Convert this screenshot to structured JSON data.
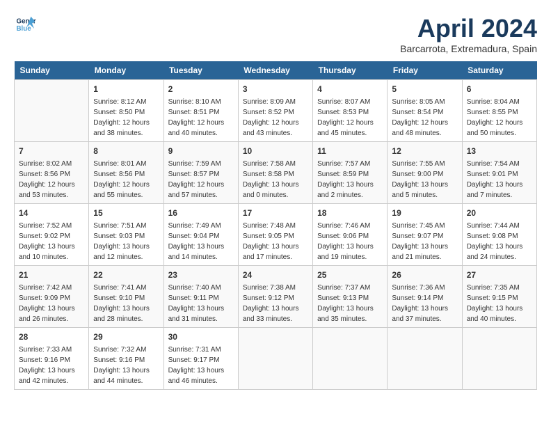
{
  "header": {
    "logo_line1": "General",
    "logo_line2": "Blue",
    "month": "April 2024",
    "location": "Barcarrota, Extremadura, Spain"
  },
  "weekdays": [
    "Sunday",
    "Monday",
    "Tuesday",
    "Wednesday",
    "Thursday",
    "Friday",
    "Saturday"
  ],
  "weeks": [
    [
      {
        "day": "",
        "info": ""
      },
      {
        "day": "1",
        "info": "Sunrise: 8:12 AM\nSunset: 8:50 PM\nDaylight: 12 hours\nand 38 minutes."
      },
      {
        "day": "2",
        "info": "Sunrise: 8:10 AM\nSunset: 8:51 PM\nDaylight: 12 hours\nand 40 minutes."
      },
      {
        "day": "3",
        "info": "Sunrise: 8:09 AM\nSunset: 8:52 PM\nDaylight: 12 hours\nand 43 minutes."
      },
      {
        "day": "4",
        "info": "Sunrise: 8:07 AM\nSunset: 8:53 PM\nDaylight: 12 hours\nand 45 minutes."
      },
      {
        "day": "5",
        "info": "Sunrise: 8:05 AM\nSunset: 8:54 PM\nDaylight: 12 hours\nand 48 minutes."
      },
      {
        "day": "6",
        "info": "Sunrise: 8:04 AM\nSunset: 8:55 PM\nDaylight: 12 hours\nand 50 minutes."
      }
    ],
    [
      {
        "day": "7",
        "info": "Sunrise: 8:02 AM\nSunset: 8:56 PM\nDaylight: 12 hours\nand 53 minutes."
      },
      {
        "day": "8",
        "info": "Sunrise: 8:01 AM\nSunset: 8:56 PM\nDaylight: 12 hours\nand 55 minutes."
      },
      {
        "day": "9",
        "info": "Sunrise: 7:59 AM\nSunset: 8:57 PM\nDaylight: 12 hours\nand 57 minutes."
      },
      {
        "day": "10",
        "info": "Sunrise: 7:58 AM\nSunset: 8:58 PM\nDaylight: 13 hours\nand 0 minutes."
      },
      {
        "day": "11",
        "info": "Sunrise: 7:57 AM\nSunset: 8:59 PM\nDaylight: 13 hours\nand 2 minutes."
      },
      {
        "day": "12",
        "info": "Sunrise: 7:55 AM\nSunset: 9:00 PM\nDaylight: 13 hours\nand 5 minutes."
      },
      {
        "day": "13",
        "info": "Sunrise: 7:54 AM\nSunset: 9:01 PM\nDaylight: 13 hours\nand 7 minutes."
      }
    ],
    [
      {
        "day": "14",
        "info": "Sunrise: 7:52 AM\nSunset: 9:02 PM\nDaylight: 13 hours\nand 10 minutes."
      },
      {
        "day": "15",
        "info": "Sunrise: 7:51 AM\nSunset: 9:03 PM\nDaylight: 13 hours\nand 12 minutes."
      },
      {
        "day": "16",
        "info": "Sunrise: 7:49 AM\nSunset: 9:04 PM\nDaylight: 13 hours\nand 14 minutes."
      },
      {
        "day": "17",
        "info": "Sunrise: 7:48 AM\nSunset: 9:05 PM\nDaylight: 13 hours\nand 17 minutes."
      },
      {
        "day": "18",
        "info": "Sunrise: 7:46 AM\nSunset: 9:06 PM\nDaylight: 13 hours\nand 19 minutes."
      },
      {
        "day": "19",
        "info": "Sunrise: 7:45 AM\nSunset: 9:07 PM\nDaylight: 13 hours\nand 21 minutes."
      },
      {
        "day": "20",
        "info": "Sunrise: 7:44 AM\nSunset: 9:08 PM\nDaylight: 13 hours\nand 24 minutes."
      }
    ],
    [
      {
        "day": "21",
        "info": "Sunrise: 7:42 AM\nSunset: 9:09 PM\nDaylight: 13 hours\nand 26 minutes."
      },
      {
        "day": "22",
        "info": "Sunrise: 7:41 AM\nSunset: 9:10 PM\nDaylight: 13 hours\nand 28 minutes."
      },
      {
        "day": "23",
        "info": "Sunrise: 7:40 AM\nSunset: 9:11 PM\nDaylight: 13 hours\nand 31 minutes."
      },
      {
        "day": "24",
        "info": "Sunrise: 7:38 AM\nSunset: 9:12 PM\nDaylight: 13 hours\nand 33 minutes."
      },
      {
        "day": "25",
        "info": "Sunrise: 7:37 AM\nSunset: 9:13 PM\nDaylight: 13 hours\nand 35 minutes."
      },
      {
        "day": "26",
        "info": "Sunrise: 7:36 AM\nSunset: 9:14 PM\nDaylight: 13 hours\nand 37 minutes."
      },
      {
        "day": "27",
        "info": "Sunrise: 7:35 AM\nSunset: 9:15 PM\nDaylight: 13 hours\nand 40 minutes."
      }
    ],
    [
      {
        "day": "28",
        "info": "Sunrise: 7:33 AM\nSunset: 9:16 PM\nDaylight: 13 hours\nand 42 minutes."
      },
      {
        "day": "29",
        "info": "Sunrise: 7:32 AM\nSunset: 9:16 PM\nDaylight: 13 hours\nand 44 minutes."
      },
      {
        "day": "30",
        "info": "Sunrise: 7:31 AM\nSunset: 9:17 PM\nDaylight: 13 hours\nand 46 minutes."
      },
      {
        "day": "",
        "info": ""
      },
      {
        "day": "",
        "info": ""
      },
      {
        "day": "",
        "info": ""
      },
      {
        "day": "",
        "info": ""
      }
    ]
  ]
}
